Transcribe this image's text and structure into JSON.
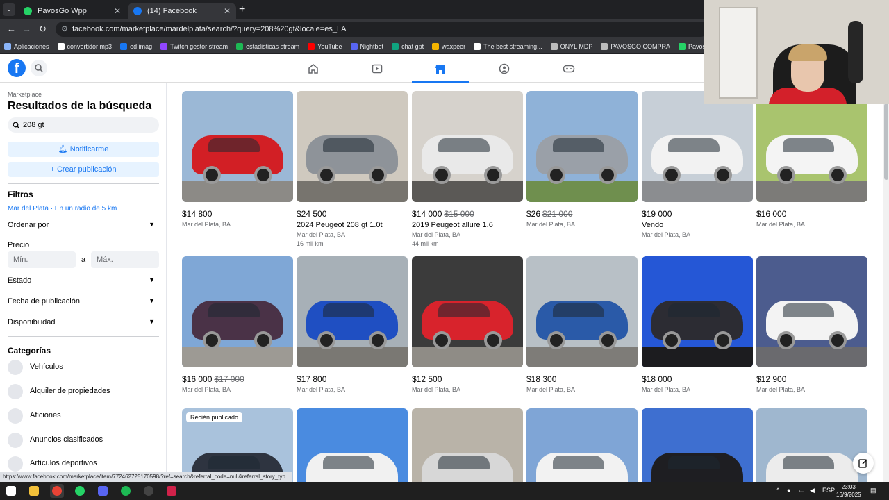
{
  "browser": {
    "tabs": [
      {
        "title": "PavosGo Wpp",
        "active": false
      },
      {
        "title": "(14) Facebook",
        "active": true
      }
    ],
    "url": "facebook.com/marketplace/mardelplata/search/?query=208%20gt&locale=es_LA",
    "bookmarks": [
      "Aplicaciones",
      "convertidor mp3",
      "ed imag",
      "Twitch gestor stream",
      "estadisticas stream",
      "YouTube",
      "Nightbot",
      "chat gpt",
      "waxpeer",
      "The best streaming...",
      "ONYL MDP",
      "PAVOSGO COMPRA",
      "PavosGo Wpp"
    ],
    "status_url": "https://www.facebook.com/marketplace/item/772462725170598/?ref=search&referral_code=null&referral_story_typ..."
  },
  "sidebar": {
    "crumb": "Marketplace",
    "title": "Resultados de la búsqueda",
    "search_value": "208 gt",
    "notify_label": "Notificarme",
    "create_label": "Crear publicación",
    "filters_heading": "Filtros",
    "location": "Mar del Plata · En un radio de 5 km",
    "sort_label": "Ordenar por",
    "price_label": "Precio",
    "price_min_placeholder": "Mín.",
    "price_max_placeholder": "Máx.",
    "price_sep": "a",
    "state_label": "Estado",
    "date_label": "Fecha de publicación",
    "availability_label": "Disponibilidad",
    "categories_heading": "Categorías",
    "categories": [
      "Vehículos",
      "Alquiler de propiedades",
      "Aficiones",
      "Anuncios clasificados",
      "Artículos deportivos"
    ]
  },
  "listings": [
    {
      "price": "$14 800",
      "old_price": "",
      "title": "",
      "location": "Mar del Plata, BA",
      "km": "",
      "badge": "",
      "color": "#d21f25",
      "sky": "#9bb8d6",
      "ground": "#8c8a86"
    },
    {
      "price": "$24 500",
      "old_price": "",
      "title": "2024 Peugeot 208 gt 1.0t",
      "location": "Mar del Plata, BA",
      "km": "16 mil km",
      "badge": "",
      "color": "#8e9399",
      "sky": "#cfc9bf",
      "ground": "#77746e"
    },
    {
      "price": "$14 000",
      "old_price": "$15 000",
      "title": "2019 Peugeot allure 1.6",
      "location": "Mar del Plata, BA",
      "km": "44 mil km",
      "badge": "",
      "color": "#e9e9e9",
      "sky": "#d6d2cc",
      "ground": "#5b5956"
    },
    {
      "price": "$26",
      "old_price": "$21 000",
      "title": "",
      "location": "Mar del Plata, BA",
      "km": "",
      "badge": "",
      "color": "#9aa0a8",
      "sky": "#8fb2d8",
      "ground": "#6f8f4e"
    },
    {
      "price": "$19 000",
      "old_price": "",
      "title": "Vendo",
      "location": "Mar del Plata, BA",
      "km": "",
      "badge": "",
      "color": "#f2f2f2",
      "sky": "#c7cfd7",
      "ground": "#8b8d90"
    },
    {
      "price": "$16 000",
      "old_price": "",
      "title": "",
      "location": "Mar del Plata, BA",
      "km": "",
      "badge": "",
      "color": "#f4f4f4",
      "sky": "#a9c46e",
      "ground": "#7c7b78"
    },
    {
      "price": "$16 000",
      "old_price": "$17 000",
      "title": "",
      "location": "Mar del Plata, BA",
      "km": "",
      "badge": "",
      "color": "#4a3247",
      "sky": "#7fa7d6",
      "ground": "#9d9a94"
    },
    {
      "price": "$17 800",
      "old_price": "",
      "title": "",
      "location": "Mar del Plata, BA",
      "km": "",
      "badge": "",
      "color": "#1f4fc2",
      "sky": "#a7b0b7",
      "ground": "#7a7873"
    },
    {
      "price": "$12 500",
      "old_price": "",
      "title": "",
      "location": "Mar del Plata, BA",
      "km": "",
      "badge": "",
      "color": "#d8232c",
      "sky": "#3b3b3b",
      "ground": "#8f8c86"
    },
    {
      "price": "$18 300",
      "old_price": "",
      "title": "",
      "location": "Mar del Plata, BA",
      "km": "",
      "badge": "",
      "color": "#2a5aa8",
      "sky": "#b8c0c6",
      "ground": "#7e7c78"
    },
    {
      "price": "$18 000",
      "old_price": "",
      "title": "",
      "location": "Mar del Plata, BA",
      "km": "",
      "badge": "",
      "color": "#2c2c33",
      "sky": "#2557d6",
      "ground": "#1c1c1f"
    },
    {
      "price": "$12 900",
      "old_price": "",
      "title": "",
      "location": "Mar del Plata, BA",
      "km": "",
      "badge": "",
      "color": "#f3f3f3",
      "sky": "#4c5c8e",
      "ground": "#6a6a6e"
    },
    {
      "price": "",
      "old_price": "",
      "title": "",
      "location": "",
      "km": "",
      "badge": "Recién publicado",
      "color": "#2e3440",
      "sky": "#a9c2dc",
      "ground": "#8a8783"
    },
    {
      "price": "",
      "old_price": "",
      "title": "",
      "location": "",
      "km": "",
      "badge": "",
      "color": "#f1f1f1",
      "sky": "#4a8be0",
      "ground": "#8c8a86"
    },
    {
      "price": "",
      "old_price": "",
      "title": "",
      "location": "",
      "km": "",
      "badge": "",
      "color": "#d7d7d7",
      "sky": "#b9b3a8",
      "ground": "#5c5a57"
    },
    {
      "price": "",
      "old_price": "",
      "title": "",
      "location": "",
      "km": "",
      "badge": "",
      "color": "#f2f2f2",
      "sky": "#7fa5d6",
      "ground": "#4c6d3a"
    },
    {
      "price": "",
      "old_price": "",
      "title": "",
      "location": "",
      "km": "",
      "badge": "",
      "color": "#1e1e22",
      "sky": "#3e6fd0",
      "ground": "#6f6e6a"
    },
    {
      "price": "",
      "old_price": "",
      "title": "",
      "location": "",
      "km": "",
      "badge": "",
      "color": "#ececec",
      "sky": "#9fb7cf",
      "ground": "#7b7a76"
    }
  ],
  "taskbar": {
    "lang": "ESP",
    "time": "23:03",
    "date": "16/9/2025"
  },
  "colors": {
    "accent": "#1877f2"
  }
}
